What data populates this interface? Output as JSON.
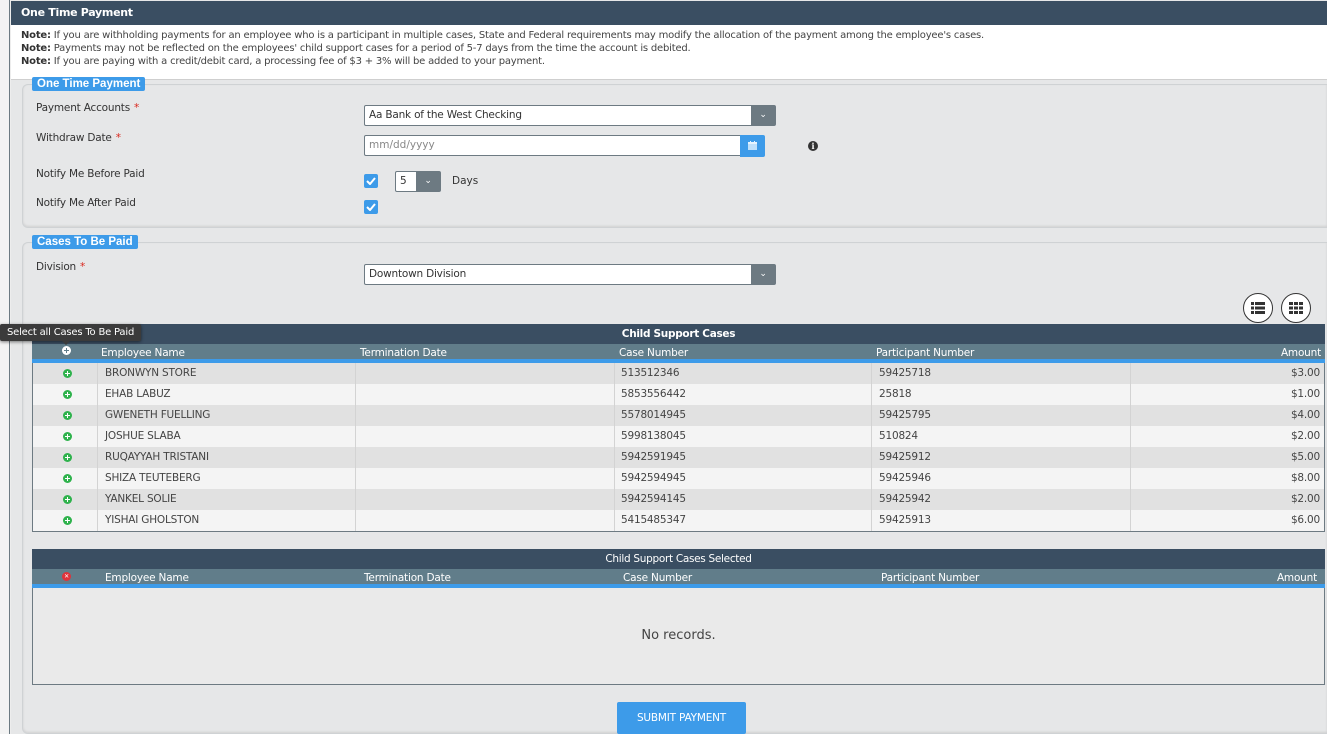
{
  "panel": {
    "title": "One Time Payment",
    "notes": [
      {
        "prefix": "Note:",
        "text": " If you are withholding payments for an employee who is a participant in multiple cases, State and Federal requirements may modify the allocation of the payment among the employee's cases."
      },
      {
        "prefix": "Note:",
        "text": " Payments may not be reflected on the employees' child support cases for a period of 5-7 days from the time the account is debited."
      },
      {
        "prefix": "Note:",
        "text": " If you are paying with a credit/debit card, a processing fee of $3 + 3% will be added to your payment."
      }
    ]
  },
  "payment_section": {
    "legend": "One Time Payment",
    "payment_accounts_label": "Payment Accounts",
    "payment_accounts_value": "Aa Bank of the West Checking",
    "withdraw_date_label": "Withdraw Date",
    "withdraw_date_placeholder": "mm/dd/yyyy",
    "notify_before_label": "Notify Me Before Paid",
    "notify_before_checked": true,
    "notify_days_value": "5",
    "days_label": "Days",
    "notify_after_label": "Notify Me After Paid",
    "notify_after_checked": true,
    "required_marker": "*"
  },
  "cases_section": {
    "legend": "Cases To Be Paid",
    "division_label": "Division",
    "division_value": "Downtown Division",
    "tooltip": "Select all Cases To Be Paid"
  },
  "cases_grid": {
    "title": "Child Support Cases",
    "columns": [
      "Employee Name",
      "Termination Date",
      "Case Number",
      "Participant Number",
      "Amount"
    ],
    "rows": [
      {
        "employee": "BRONWYN STORE",
        "termination": "",
        "case": "513512346",
        "participant": "59425718",
        "amount": "$3.00"
      },
      {
        "employee": "EHAB LABUZ",
        "termination": "",
        "case": "5853556442",
        "participant": "25818",
        "amount": "$1.00"
      },
      {
        "employee": "GWENETH FUELLING",
        "termination": "",
        "case": "5578014945",
        "participant": "59425795",
        "amount": "$4.00"
      },
      {
        "employee": "JOSHUE SLABA",
        "termination": "",
        "case": "5998138045",
        "participant": "510824",
        "amount": "$2.00"
      },
      {
        "employee": "RUQAYYAH TRISTANI",
        "termination": "",
        "case": "5942591945",
        "participant": "59425912",
        "amount": "$5.00"
      },
      {
        "employee": "SHIZA TEUTEBERG",
        "termination": "",
        "case": "5942594945",
        "participant": "59425946",
        "amount": "$8.00"
      },
      {
        "employee": "YANKEL SOLIE",
        "termination": "",
        "case": "5942594145",
        "participant": "59425942",
        "amount": "$2.00"
      },
      {
        "employee": "YISHAI GHOLSTON",
        "termination": "",
        "case": "5415485347",
        "participant": "59425913",
        "amount": "$6.00"
      }
    ]
  },
  "selected_grid": {
    "title": "Child Support Cases Selected",
    "columns": [
      "Employee Name",
      "Termination Date",
      "Case Number",
      "Participant Number",
      "Amount"
    ],
    "empty_text": "No records."
  },
  "actions": {
    "submit_label": "SUBMIT PAYMENT"
  },
  "colors": {
    "header": "#3a4e62",
    "accent": "#3d9be9",
    "column_header": "#617d8a",
    "add": "#2eb24c",
    "remove": "#e0323b"
  }
}
